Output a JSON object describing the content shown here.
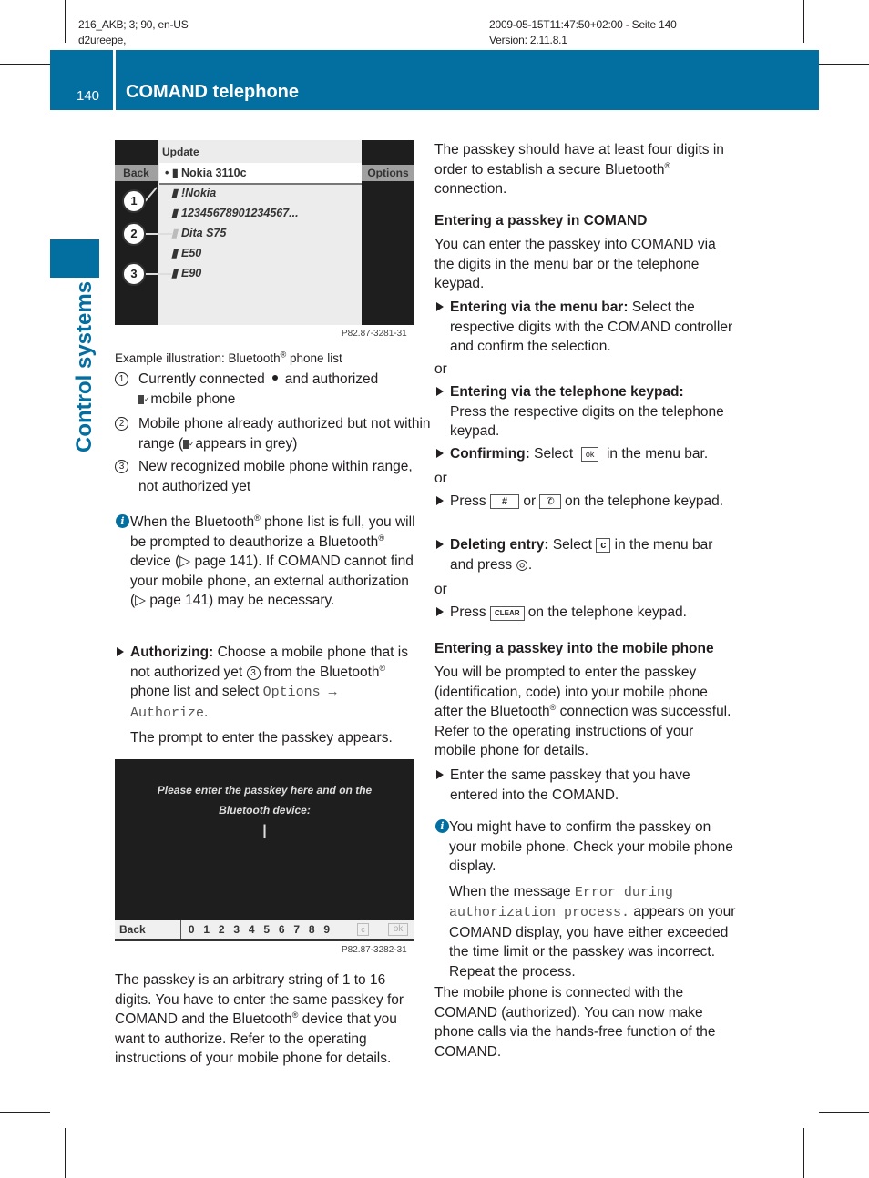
{
  "meta": {
    "left_line1": "216_AKB; 3; 90, en-US",
    "left_line2": "d2ureepe,",
    "right_line1": "2009-05-15T11:47:50+02:00 - Seite 140",
    "right_line2": "Version: 2.11.8.1"
  },
  "header": {
    "page_number": "140",
    "title": "COMAND telephone",
    "color": "#036ea0"
  },
  "side_tab": {
    "label": "Control systems"
  },
  "figure1": {
    "screen": {
      "header": "Update",
      "back": "Back",
      "options": "Options",
      "rows": [
        {
          "icon": "connected-authorized-phone-icon",
          "name": "Nokia 3110c"
        },
        {
          "icon": "phone-icon",
          "name": "!Nokia"
        },
        {
          "icon": "phone-icon",
          "name": "12345678901234567..."
        },
        {
          "icon": "authorized-grey-phone-icon",
          "name": "Dita S75"
        },
        {
          "icon": "phone-icon",
          "name": "E50"
        },
        {
          "icon": "phone-icon",
          "name": "E90"
        }
      ],
      "callouts": [
        "1",
        "2",
        "3"
      ],
      "code": "P82.87-3281-31"
    },
    "caption": "Example illustration: Bluetooth",
    "caption_suffix": " phone list",
    "legend": [
      {
        "num": "1",
        "text_a": "Currently connected",
        "text_b": "and authorized",
        "text_c": "mobile phone"
      },
      {
        "num": "2",
        "text_a": "Mobile phone already authorized but not within range (",
        "text_b": " appears in grey)"
      },
      {
        "num": "3",
        "text": "New recognized mobile phone within range, not authorized yet"
      }
    ]
  },
  "info1": {
    "p1": "When the Bluetooth",
    "p2": " phone list is full, you will be prompted to deauthorize a Bluetooth",
    "p3": " device (▷ page 141). If COMAND cannot find your mobile phone, an external authorization (▷ page 141) may be necessary."
  },
  "authorizing": {
    "label": "Authorizing:",
    "text_a": " Choose a mobile phone that is not authorized yet ",
    "num": "3",
    "text_b": " from the Bluetooth",
    "text_c": " phone list and select ",
    "mono": "Options → Authorize",
    "text_d": ".",
    "result": "The prompt to enter the passkey appears."
  },
  "figure2": {
    "message_line1": "Please enter the passkey here and on the",
    "message_line2": "Bluetooth device:",
    "cursor": "|",
    "back": "Back",
    "digits": [
      "0",
      "1",
      "2",
      "3",
      "4",
      "5",
      "6",
      "7",
      "8",
      "9"
    ],
    "clear_key": "c",
    "ok_key": "ok",
    "code": "P82.87-3282-31"
  },
  "passkey_para": {
    "a": "The passkey is an arbitrary string of 1 to 16 digits. You have to enter the same passkey for COMAND and the Bluetooth",
    "b": " device that you want to authorize. Refer to the operating instructions of your mobile phone for details."
  },
  "right": {
    "intro_a": "The passkey should have at least four digits in order to establish a secure Bluetooth",
    "intro_b": " connection.",
    "h1": "Entering a passkey in COMAND",
    "p1": "You can enter the passkey into COMAND via the digits in the menu bar or the telephone keypad.",
    "b1_label": "Entering via the menu bar:",
    "b1_text": " Select the respective digits with the COMAND controller and confirm the selection.",
    "or": "or",
    "b2_label": "Entering via the telephone keypad:",
    "b2_text": "Press the respective digits on the telephone keypad.",
    "b3_label": "Confirming:",
    "b3_a": " Select ",
    "b3_key": "ok",
    "b3_b": " in the menu bar.",
    "b4_a": "Press ",
    "b4_key1": "#",
    "b4_or": " or ",
    "b4_b": " on the telephone keypad.",
    "b5_label": "Deleting entry:",
    "b5_a": " Select ",
    "b5_key": "c",
    "b5_b": " in the menu bar and press ",
    "b5_c": ".",
    "b6_a": "Press ",
    "b6_key": "CLEAR",
    "b6_b": " on the telephone keypad.",
    "h2": "Entering a passkey into the mobile phone",
    "p2_a": "You will be prompted to enter the passkey (identification, code) into your mobile phone after the Bluetooth",
    "p2_b": " connection was successful. Refer to the operating instructions of your mobile phone for details.",
    "b7": "Enter the same passkey that you have entered into the COMAND.",
    "info_a": "You might have to confirm the passkey on your mobile phone. Check your mobile phone display.",
    "info_b1": "When the message ",
    "info_mono": "Error during authorization process.",
    "info_b2": " appears on your COMAND display, you have either exceeded the time limit or the passkey was incorrect. Repeat the process.",
    "final": "The mobile phone is connected with the COMAND (authorized). You can now make phone calls via the hands-free function of the COMAND."
  },
  "registered_mark": "®"
}
